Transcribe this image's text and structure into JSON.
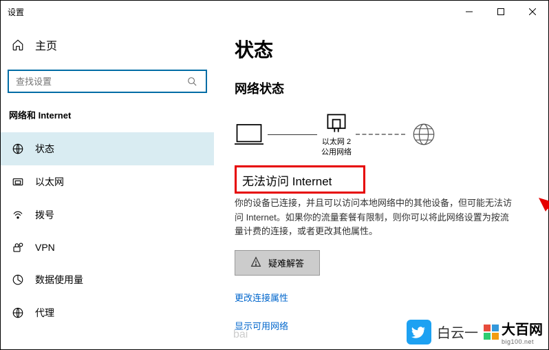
{
  "window": {
    "title": "设置"
  },
  "sidebar": {
    "home": "主页",
    "search_placeholder": "查找设置",
    "category": "网络和 Internet",
    "items": [
      {
        "label": "状态"
      },
      {
        "label": "以太网"
      },
      {
        "label": "拨号"
      },
      {
        "label": "VPN"
      },
      {
        "label": "数据使用量"
      },
      {
        "label": "代理"
      }
    ]
  },
  "main": {
    "title": "状态",
    "section": "网络状态",
    "adapter_name": "以太网 2",
    "adapter_type": "公用网络",
    "error_heading": "无法访问 Internet",
    "description": "你的设备已连接，并且可以访问本地网络中的其他设备，但可能无法访问 Internet。如果你的流量套餐有限制，则你可以将此网络设置为按流量计费的连接，或者更改其他属性。",
    "troubleshoot_label": "疑难解答",
    "link_change": "更改连接属性",
    "link_show": "显示可用网络"
  },
  "watermark": {
    "text1": "白云一",
    "text2": "大百网",
    "sub": "big100.net",
    "baidu": "bai"
  }
}
